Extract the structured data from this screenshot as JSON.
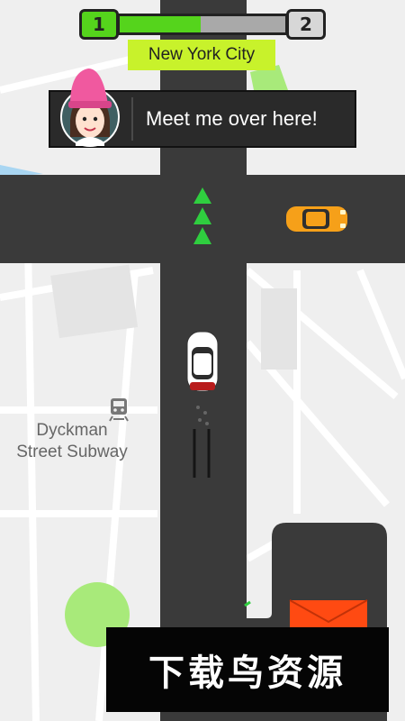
{
  "hud": {
    "current_level": "1",
    "next_level": "2",
    "progress": 0.49,
    "city": "New York City"
  },
  "dialog": {
    "message": "Meet me over here!",
    "avatar": "girl-pink-hat-avatar"
  },
  "map": {
    "poi_label": "Dyckman\nStreet Subway",
    "poi_icon": "train-icon",
    "road_color": "#3a3a3a",
    "arrow_color": "#2fce3f",
    "player_car_color": "#ffffff",
    "traffic_car_color": "#f6a019",
    "destination_color": "#ff4a12",
    "park_color": "#a8ea7a"
  },
  "watermark": {
    "text": "下载鸟资源"
  }
}
